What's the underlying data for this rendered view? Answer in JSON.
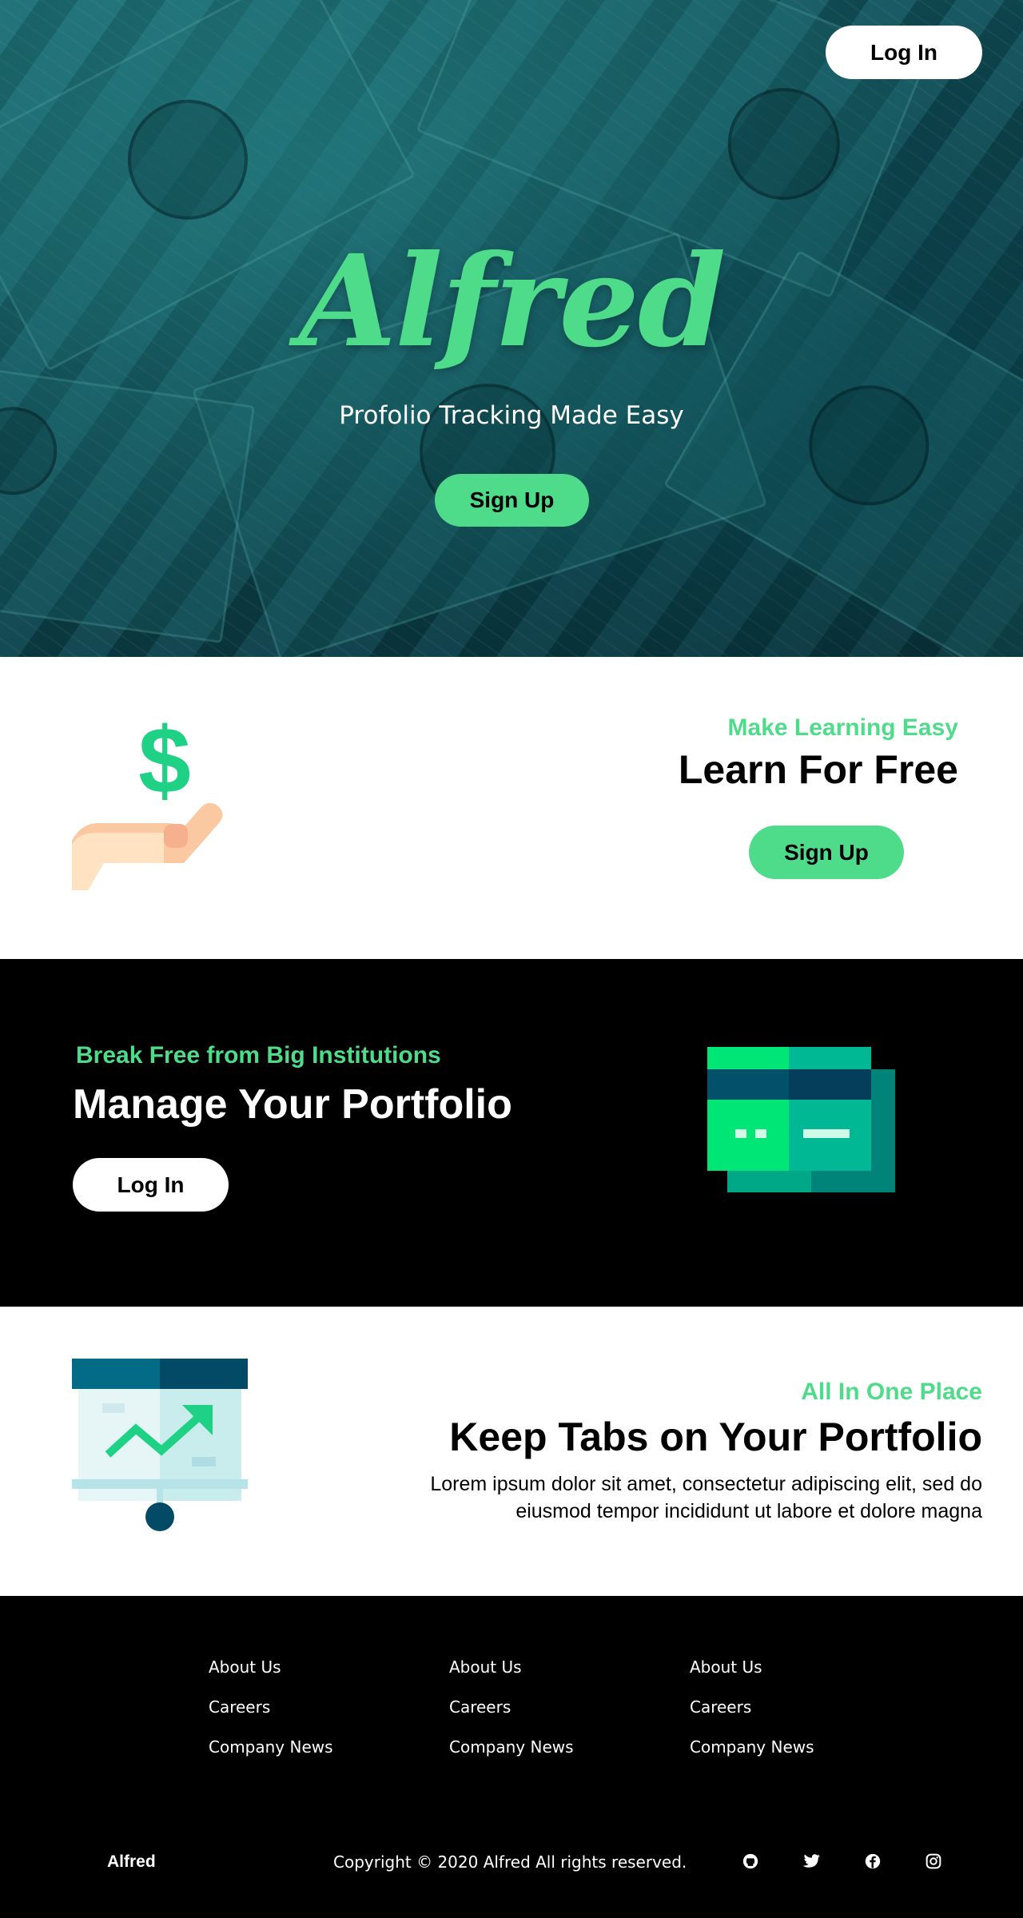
{
  "hero": {
    "login_label": "Log In",
    "logo": "Alfred",
    "tagline": "Profolio Tracking Made Easy",
    "signup_label": "Sign Up"
  },
  "learn": {
    "eyebrow": "Make Learning Easy",
    "title": "Learn For Free",
    "button_label": "Sign Up",
    "icon": "hand-dollar-icon"
  },
  "manage": {
    "eyebrow": "Break Free from Big Institutions",
    "title": "Manage Your Portfolio",
    "button_label": "Log In",
    "icon": "cards-icon"
  },
  "tabs": {
    "eyebrow": "All In One Place",
    "title": "Keep Tabs on Your Portfolio",
    "body": "Lorem ipsum dolor sit amet, consectetur adipiscing elit, sed do eiusmod tempor incididunt ut labore et dolore magna",
    "icon": "presentation-chart-icon"
  },
  "footer": {
    "columns": [
      {
        "links": [
          "About Us",
          "Careers",
          "Company News"
        ]
      },
      {
        "links": [
          "About Us",
          "Careers",
          "Company News"
        ]
      },
      {
        "links": [
          "About Us",
          "Careers",
          "Company News"
        ]
      }
    ],
    "brand": "Alfred",
    "copyright": "Copyright © 2020 Alfred All rights reserved.",
    "social": [
      "github-icon",
      "twitter-icon",
      "facebook-icon",
      "instagram-icon"
    ]
  },
  "colors": {
    "accent": "#4fdc8a",
    "dark": "#000000",
    "teal": "#0f4d57"
  }
}
